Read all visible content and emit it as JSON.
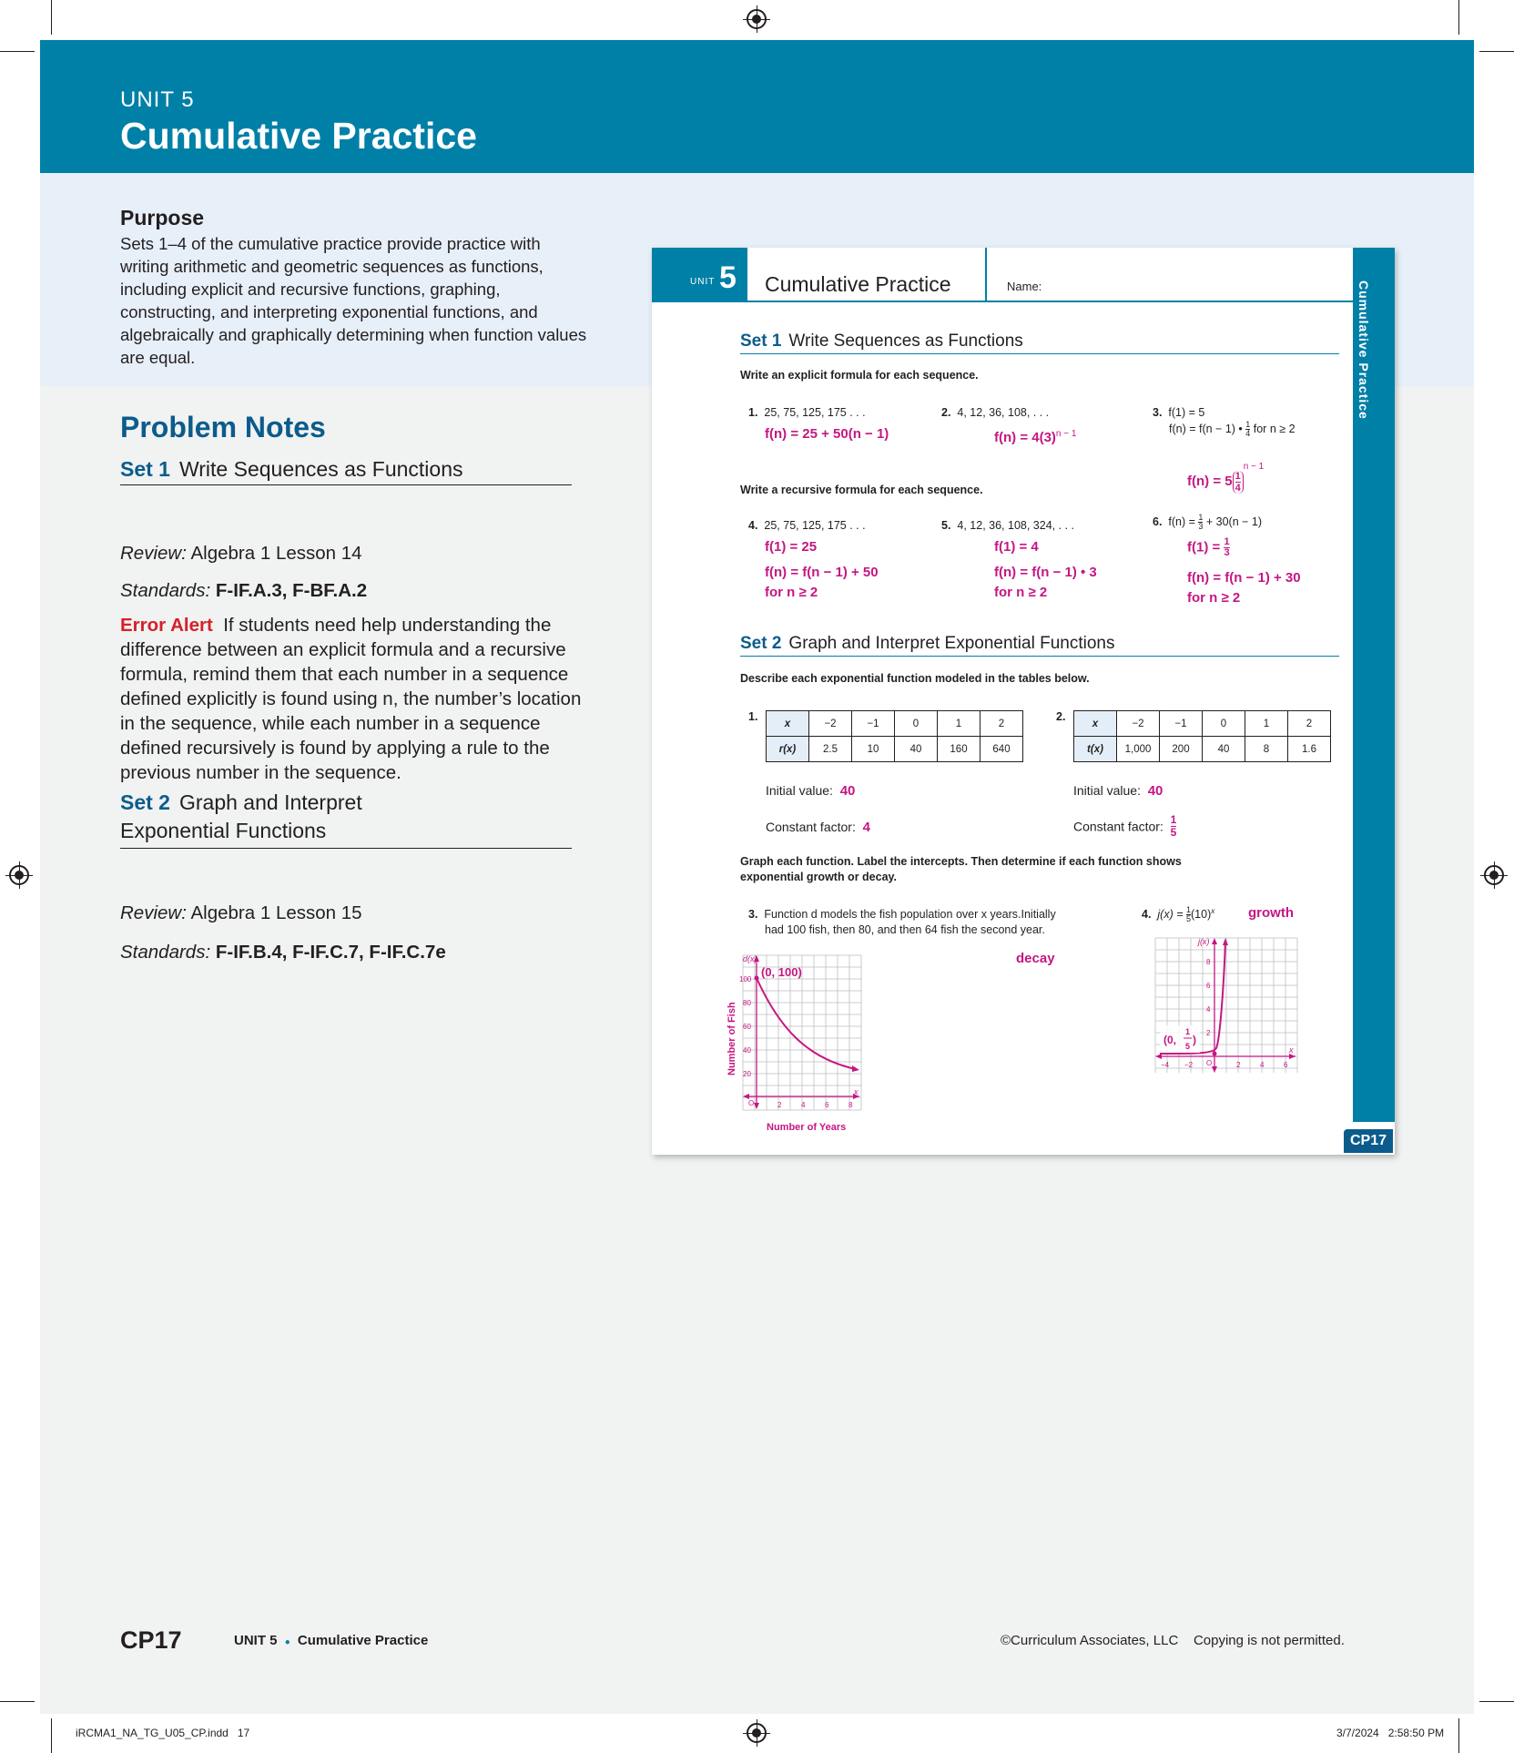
{
  "banner": {
    "unit": "UNIT 5",
    "title": "Cumulative Practice"
  },
  "purpose": {
    "heading": "Purpose",
    "text": "Sets 1–4 of the cumulative practice provide practice with writing arithmetic and geometric sequences as functions, including explicit and recursive functions, graphing, constructing, and interpreting exponential functions, and algebraically and graphically determining when function values are equal."
  },
  "notes": {
    "heading": "Problem Notes",
    "set1": {
      "num": "Set 1",
      "title": "Write Sequences as Functions",
      "review_label": "Review:",
      "review": "Algebra 1 Lesson 14",
      "standards_label": "Standards:",
      "standards": "F-IF.A.3, F-BF.A.2",
      "error_label": "Error Alert",
      "error_text": "If students need help understanding the difference between an explicit formula and a recursive formula, remind them that each number in a sequence defined explicitly is found using n, the number’s location in the sequence, while each number in a sequence defined recursively is found by applying a rule to the previous number in the sequence."
    },
    "set2": {
      "num": "Set 2",
      "title_1": "Graph and Interpret",
      "title_2": "Exponential Functions",
      "review_label": "Review:",
      "review": "Algebra 1 Lesson 15",
      "standards_label": "Standards:",
      "standards": "F-IF.B.4, F-IF.C.7, F-IF.C.7e"
    }
  },
  "card": {
    "unit_word": "UNIT",
    "unit_num": "5",
    "title": "Cumulative Practice",
    "name_label": "Name:",
    "sidebar": "Cumulative Practice",
    "tab": "CP17",
    "set1": {
      "num": "Set 1",
      "title": "Write Sequences as Functions",
      "explicit_instr": "Write an explicit formula for each sequence.",
      "recursive_instr": "Write a recursive formula for each sequence.",
      "q1": "25, 75, 125, 175 . . .",
      "a1": "f(n) = 25 + 50(n − 1)",
      "q2": "4, 12, 36, 108, . . .",
      "a2": "f(n) = 4(3)",
      "a2_exp": "n − 1",
      "q3_line1": "f(1) = 5",
      "q3_line2": "f(n) = f(n − 1) • ",
      "q3_frac_n": "1",
      "q3_frac_d": "4",
      "q3_tail": " for n ≥ 2",
      "a3": "f(n) = 5",
      "a3_exp": "n − 1",
      "q4": "25, 75, 125, 175 . . .",
      "a4_1": "f(1) = 25",
      "a4_2": "f(n) = f(n − 1) + 50",
      "a4_3": "for n ≥ 2",
      "q5": "4, 12, 36, 108, 324, . . .",
      "a5_1": "f(1) = 4",
      "a5_2": "f(n) = f(n − 1) • 3",
      "a5_3": "for n ≥ 2",
      "q6_pre": "f(n) = ",
      "q6_frac_n": "1",
      "q6_frac_d": "3",
      "q6_post": " + 30(n − 1)",
      "a6_1": "f(1) = ",
      "a6_frac_n": "1",
      "a6_frac_d": "3",
      "a6_2": "f(n) = f(n − 1) + 30",
      "a6_3": "for n ≥ 2"
    },
    "set2": {
      "num": "Set 2",
      "title": "Graph and Interpret Exponential Functions",
      "describe_instr": "Describe each exponential function modeled in the tables below.",
      "table1": {
        "row1": [
          "x",
          "−2",
          "−1",
          "0",
          "1",
          "2"
        ],
        "row2": [
          "r(x)",
          "2.5",
          "10",
          "40",
          "160",
          "640"
        ]
      },
      "table2": {
        "row1": [
          "x",
          "−2",
          "−1",
          "0",
          "1",
          "2"
        ],
        "row2": [
          "t(x)",
          "1,000",
          "200",
          "40",
          "8",
          "1.6"
        ]
      },
      "initial_label": "Initial value:",
      "t1_initial": "40",
      "t2_initial": "40",
      "factor_label": "Constant factor:",
      "t1_factor": "4",
      "t2_factor_n": "1",
      "t2_factor_d": "5",
      "graph_instr_1": "Graph each function. Label the intercepts. Then determine if each function shows",
      "graph_instr_2": "exponential growth or decay.",
      "q3_1": "Function d models the fish population over x years.Initially",
      "q3_2": "had 100 fish, then 80, and then 64 fish the second year.",
      "q3_answer": "decay",
      "q4_pre": "j(x) = ",
      "q4_frac_n": "1",
      "q4_frac_d": "5",
      "q4_post": "(10)",
      "q4_answer": "growth",
      "g1_point": "(0, 100)",
      "g1_ylabel": "Number of Fish",
      "g1_xlabel": "Number of Years",
      "g1_yaxis": "d(x)",
      "g1_x": "x",
      "g1_origin": "O",
      "g1_yticks": [
        "100",
        "80",
        "60",
        "40",
        "20"
      ],
      "g1_xticks": [
        "2",
        "4",
        "6",
        "8"
      ],
      "g2_yaxis": "j(x)",
      "g2_x": "x",
      "g2_origin": "O",
      "g2_point_pre": "(0, ",
      "g2_point_n": "1",
      "g2_point_d": "5",
      "g2_point_post": ")",
      "g2_yticks": [
        "8",
        "6",
        "4",
        "2"
      ],
      "g2_xticks": [
        "−4",
        "−2",
        "2",
        "4",
        "6"
      ]
    }
  },
  "footer": {
    "cp": "CP17",
    "unit": "UNIT 5",
    "bullet": "●",
    "section": "Cumulative Practice",
    "copyright": "©Curriculum Associates, LLC    Copying is not permitted.",
    "slug_left": "iRCMA1_NA_TG_U05_CP.indd   17",
    "slug_right": "3/7/2024   2:58:50 PM"
  },
  "colors": {
    "banner": "#0080a7",
    "heading_blue": "#0b5c8c",
    "answer_magenta": "#c51683",
    "error_red": "#d42027"
  }
}
